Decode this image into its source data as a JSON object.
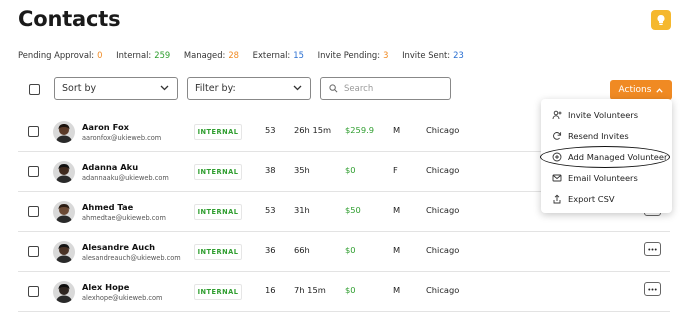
{
  "page": {
    "title": "Contacts"
  },
  "colors": {
    "accent": "#f08a23",
    "hint": "#f5b82e",
    "green": "#2f9e2f",
    "blue": "#2a6fd1"
  },
  "stats": [
    {
      "label": "Pending Approval:",
      "value": "0",
      "color": "#f08a23"
    },
    {
      "label": "Internal:",
      "value": "259",
      "color": "#2f9e2f"
    },
    {
      "label": "Managed:",
      "value": "28",
      "color": "#f08a23"
    },
    {
      "label": "External:",
      "value": "15",
      "color": "#2a6fd1"
    },
    {
      "label": "Invite Pending:",
      "value": "3",
      "color": "#f08a23"
    },
    {
      "label": "Invite Sent:",
      "value": "23",
      "color": "#2a6fd1"
    }
  ],
  "toolbar": {
    "sort_label": "Sort by",
    "filter_label": "Filter by:",
    "search_placeholder": "Search",
    "actions_label": "Actions"
  },
  "actions_menu": [
    {
      "label": "Invite Volunteers",
      "icon": "person-add-icon"
    },
    {
      "label": "Resend Invites",
      "icon": "refresh-icon"
    },
    {
      "label": "Add Managed Volunteer",
      "icon": "plus-circle-icon",
      "highlighted": true
    },
    {
      "label": "Email Volunteers",
      "icon": "mail-icon"
    },
    {
      "label": "Export CSV",
      "icon": "export-icon"
    }
  ],
  "contacts": [
    {
      "name": "Aaron Fox",
      "email": "aaronfox@ukieweb.com",
      "type": "INTERNAL",
      "age": "53",
      "hours": "26h 15m",
      "amount": "$259.9",
      "gender": "M",
      "city": "Chicago"
    },
    {
      "name": "Adanna Aku",
      "email": "adannaaku@ukieweb.com",
      "type": "INTERNAL",
      "age": "38",
      "hours": "35h",
      "amount": "$0",
      "gender": "F",
      "city": "Chicago"
    },
    {
      "name": "Ahmed Tae",
      "email": "ahmedtae@ukieweb.com",
      "type": "INTERNAL",
      "age": "53",
      "hours": "31h",
      "amount": "$50",
      "gender": "M",
      "city": "Chicago"
    },
    {
      "name": "Alesandre Auch",
      "email": "alesandreauch@ukieweb.com",
      "type": "INTERNAL",
      "age": "36",
      "hours": "66h",
      "amount": "$0",
      "gender": "M",
      "city": "Chicago"
    },
    {
      "name": "Alex Hope",
      "email": "alexhope@ukieweb.com",
      "type": "INTERNAL",
      "age": "16",
      "hours": "7h 15m",
      "amount": "$0",
      "gender": "M",
      "city": "Chicago"
    }
  ]
}
